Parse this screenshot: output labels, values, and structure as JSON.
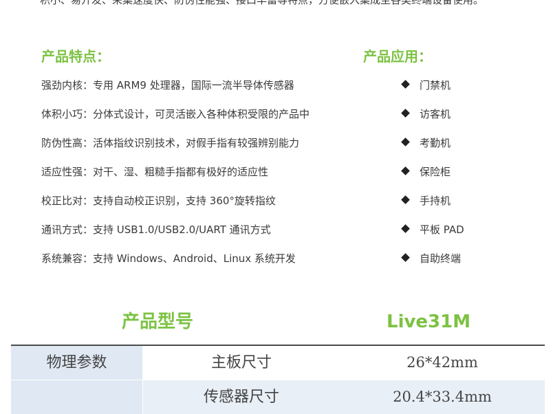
{
  "intro": {
    "text": "积小、易开发、采集速度快、防伪性能强、接口丰富等特点，方便嵌入集成至各类终端设备使用。"
  },
  "features": {
    "title": "产品特点：",
    "items": [
      "强劲内核：专用 ARM9 处理器，国际一流半导体传感器",
      "体积小巧：分体式设计，可灵活嵌入各种体积受限的产品中",
      "防伪性高：活体指纹识别技术，对假手指有较强辨别能力",
      "适应性强：对干、湿、粗糙手指都有极好的适应性",
      "校正比对：支持自动校正识别，支持 360°旋转指纹",
      "通讯方式：支持 USB1.0/USB2.0/UART 通讯方式",
      "系统兼容：支持 Windows、Android、Linux 系统开发"
    ]
  },
  "applications": {
    "title": "产品应用：",
    "items": [
      "门禁机",
      "访客机",
      "考勤机",
      "保险柜",
      "手持机",
      "平板 PAD",
      "自助终端"
    ]
  },
  "model": {
    "label": "产品型号",
    "value": "Live31M"
  },
  "specs": {
    "rows": [
      {
        "category": "物理参数",
        "key": "主板尺寸",
        "value": "26*42mm"
      },
      {
        "category": "",
        "key": "传感器尺寸",
        "value": "20.4*33.4mm"
      }
    ]
  },
  "colors": {
    "accent_green": "#7cc242",
    "table_blue": "#dfe8f3",
    "text": "#3a3a3a"
  }
}
